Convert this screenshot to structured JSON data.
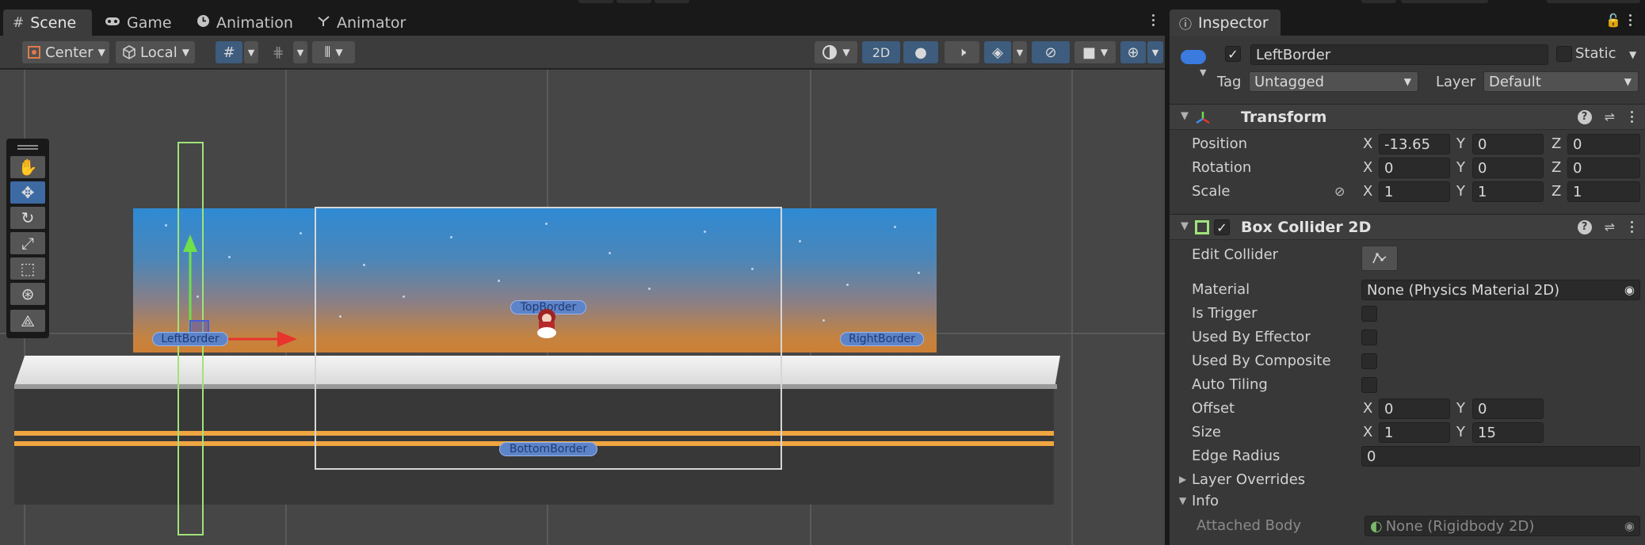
{
  "scene_tabs": [
    {
      "label": "Scene",
      "icon": "hash-icon"
    },
    {
      "label": "Game",
      "icon": "gamepad-icon"
    },
    {
      "label": "Animation",
      "icon": "clock-icon"
    },
    {
      "label": "Animator",
      "icon": "animator-icon"
    }
  ],
  "scene_toolbar": {
    "pivot": "Center",
    "space": "Local",
    "mode_2d": "2D"
  },
  "scene_objects": {
    "left_border": "LeftBorder",
    "top_border": "TopBorder",
    "right_border": "RightBorder",
    "bottom_border": "BottomBorder"
  },
  "inspector": {
    "tab_label": "Inspector",
    "object_name": "LeftBorder",
    "active": true,
    "static_label": "Static",
    "static": false,
    "tag_label": "Tag",
    "tag_value": "Untagged",
    "layer_label": "Layer",
    "layer_value": "Default",
    "transform": {
      "title": "Transform",
      "position_label": "Position",
      "rotation_label": "Rotation",
      "scale_label": "Scale",
      "position": {
        "x": "-13.65",
        "y": "0",
        "z": "0"
      },
      "rotation": {
        "x": "0",
        "y": "0",
        "z": "0"
      },
      "scale": {
        "x": "1",
        "y": "1",
        "z": "1"
      }
    },
    "axes": {
      "x": "X",
      "y": "Y",
      "z": "Z"
    },
    "box_collider": {
      "title": "Box Collider 2D",
      "enabled": true,
      "edit_collider_label": "Edit Collider",
      "material_label": "Material",
      "material_value": "None (Physics Material 2D)",
      "is_trigger_label": "Is Trigger",
      "used_by_effector_label": "Used By Effector",
      "used_by_composite_label": "Used By Composite",
      "auto_tiling_label": "Auto Tiling",
      "offset_label": "Offset",
      "offset": {
        "x": "0",
        "y": "0"
      },
      "size_label": "Size",
      "size": {
        "x": "1",
        "y": "15"
      },
      "edge_radius_label": "Edge Radius",
      "edge_radius": "0",
      "layer_overrides_label": "Layer Overrides",
      "info_label": "Info",
      "attached_body_label": "Attached Body",
      "attached_body_value": "None (Rigidbody 2D)"
    }
  },
  "colors": {
    "accent_blue": "#3d5c7e",
    "collider_green": "#9fe37a",
    "gizmo_red": "#e8342c",
    "gizmo_green": "#6ee04a",
    "ground_stripe": "#f0a640"
  }
}
